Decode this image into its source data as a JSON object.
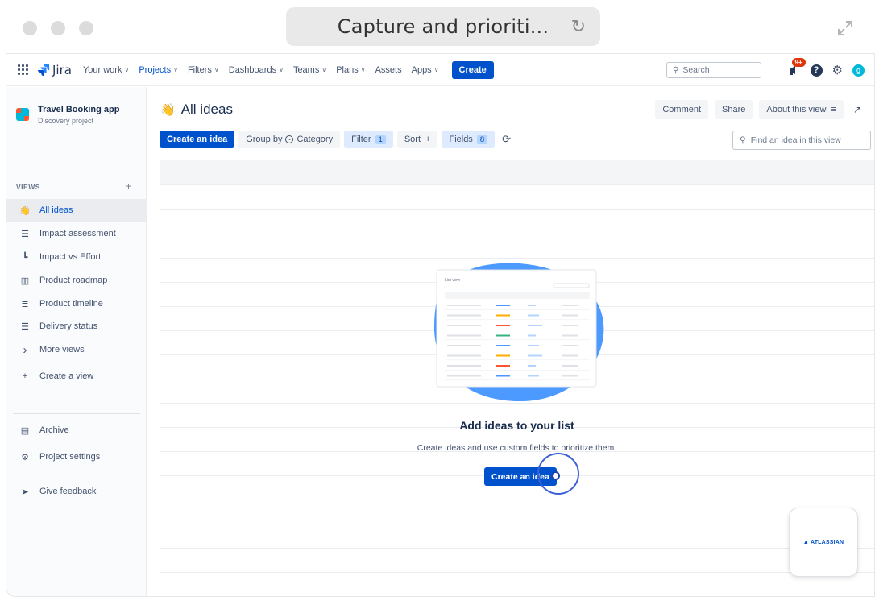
{
  "browser": {
    "url_text": "Capture and prioriti...",
    "reload_icon": "reload-icon",
    "expand_icon": "expand-icon"
  },
  "topnav": {
    "product": "Jira",
    "items": [
      {
        "label": "Your work",
        "chevron": true,
        "active": false
      },
      {
        "label": "Projects",
        "chevron": true,
        "active": true
      },
      {
        "label": "Filters",
        "chevron": true,
        "active": false
      },
      {
        "label": "Dashboards",
        "chevron": true,
        "active": false
      },
      {
        "label": "Teams",
        "chevron": true,
        "active": false
      },
      {
        "label": "Plans",
        "chevron": true,
        "active": false
      },
      {
        "label": "Assets",
        "chevron": false,
        "active": false
      },
      {
        "label": "Apps",
        "chevron": true,
        "active": false
      }
    ],
    "create_label": "Create",
    "search_placeholder": "Search",
    "notification_badge": "9+",
    "help_glyph": "?",
    "avatar_initial": "g"
  },
  "sidebar": {
    "project_name": "Travel Booking app",
    "project_type": "Discovery project",
    "views_label": "VIEWS",
    "views_add": "+",
    "items": [
      {
        "label": "All ideas",
        "icon": "hand-wave-icon",
        "active": true
      },
      {
        "label": "Impact assessment",
        "icon": "list-icon",
        "active": false
      },
      {
        "label": "Impact vs Effort",
        "icon": "scatter-matrix-icon",
        "active": false
      },
      {
        "label": "Product roadmap",
        "icon": "board-columns-icon",
        "active": false
      },
      {
        "label": "Product timeline",
        "icon": "timeline-icon",
        "active": false
      },
      {
        "label": "Delivery status",
        "icon": "list-icon",
        "active": false
      },
      {
        "label": "More views",
        "icon": "chevron-right-icon",
        "active": false
      },
      {
        "label": "Create a view",
        "icon": "plus-icon",
        "active": false
      }
    ],
    "archive_label": "Archive",
    "settings_label": "Project settings",
    "feedback_label": "Give feedback"
  },
  "main": {
    "title": "All ideas",
    "actions": {
      "comment": "Comment",
      "share": "Share",
      "about": "About this view"
    },
    "toolbar": {
      "create_idea": "Create an idea",
      "group_by": "Group by",
      "group_value": "Category",
      "filter": "Filter",
      "filter_count": "1",
      "sort": "Sort",
      "fields": "Fields",
      "fields_count": "8"
    },
    "find_placeholder": "Find an idea in this view",
    "empty_state": {
      "illustration_caption": "List view",
      "title": "Add ideas to your list",
      "description": "Create ideas and use custom fields to prioritize them.",
      "cta": "Create an idea"
    }
  },
  "widget": {
    "brand": "ATLASSIAN"
  },
  "colors": {
    "brand_blue": "#0052cc",
    "badge_red": "#de350b",
    "blob_blue": "#4c9aff"
  }
}
